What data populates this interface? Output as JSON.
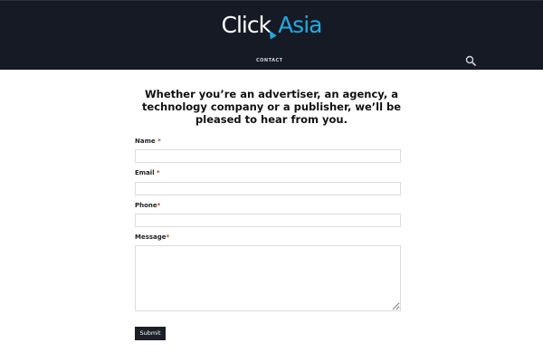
{
  "header": {
    "logo_part1": "Click",
    "logo_part2": "Asia",
    "nav_contact": "CONTACT",
    "search_icon": "search-icon"
  },
  "colors": {
    "header_bg": "#161a24",
    "brand_blue": "#24a9e1",
    "button_bg": "#1c1f26",
    "required_red": "#c0392b"
  },
  "form": {
    "heading": "Whether you’re an advertiser, an agency, a technology company or a publisher, we’ll be pleased to hear from you.",
    "name_label": "Name",
    "email_label": "Email",
    "phone_label": "Phone",
    "message_label": "Message",
    "required_mark": "*",
    "name_value": "",
    "email_value": "",
    "phone_value": "",
    "message_value": "",
    "submit_label": "Submit"
  }
}
